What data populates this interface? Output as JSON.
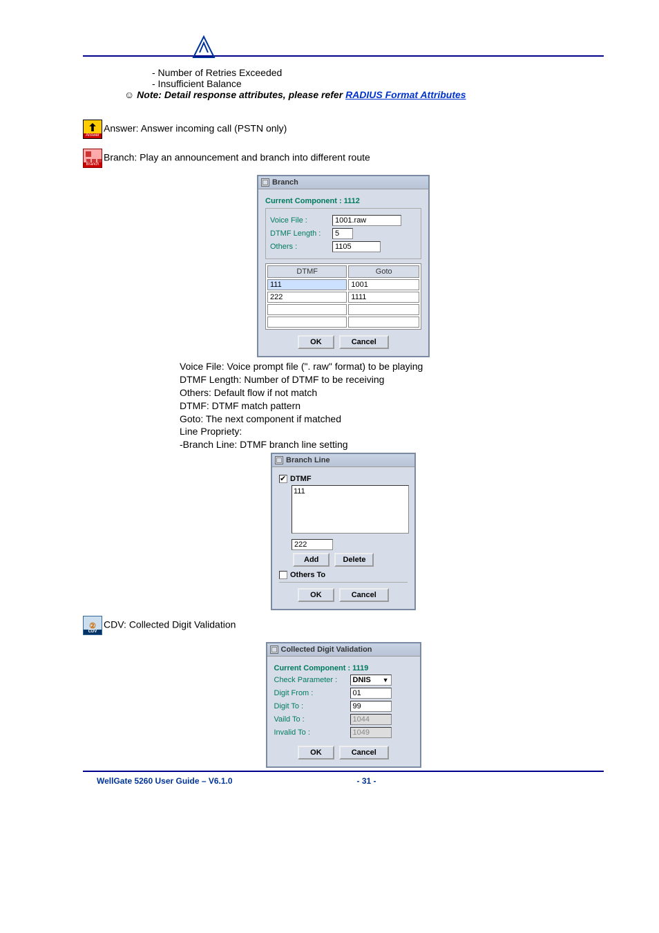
{
  "bullets": {
    "retries": "- Number of Retries Exceeded",
    "balance": "- Insufficient Balance"
  },
  "note": {
    "prefix": "☺ Note: Detail response attributes, please refer ",
    "link": "RADIUS Format Attributes"
  },
  "answer_line": "Answer: Answer incoming call (PSTN only)",
  "answer_icon_caption": "Answer",
  "branch_line": "Branch: Play an announcement and branch into different route",
  "branch_icon_caption": "Branch",
  "branch_dialog": {
    "title": "Branch",
    "current": "Current Component :  1112",
    "voice_label": "Voice File :",
    "voice_value": "1001.raw",
    "dtmf_len_label": "DTMF Length :",
    "dtmf_len_value": "5",
    "others_label": "Others :",
    "others_value": "1105",
    "col_dtmf": "DTMF",
    "col_goto": "Goto",
    "rows": [
      {
        "dtmf": "111",
        "goto": "1001"
      },
      {
        "dtmf": "222",
        "goto": "1111"
      }
    ],
    "ok": "OK",
    "cancel": "Cancel"
  },
  "desc": {
    "l1": "Voice File: Voice prompt file (\". raw\" format) to be playing",
    "l2": "DTMF Length: Number of DTMF to be receiving",
    "l3": "Others: Default flow if not match",
    "l4": "DTMF: DTMF match pattern",
    "l5": "Goto: The next component if matched",
    "l6": "Line Propriety:",
    "l7": "-Branch Line: DTMF branch line setting"
  },
  "branchline_dialog": {
    "title": "Branch Line",
    "dtmf_label": "DTMF",
    "dtmf_item": "111",
    "input_value": "222",
    "add": "Add",
    "delete": "Delete",
    "othersto_label": "Others To",
    "ok": "OK",
    "cancel": "Cancel"
  },
  "cdv_line": "CDV: Collected Digit Validation",
  "cdv_icon_caption": "CDV",
  "cdv_icon_glyph": "②",
  "cdv_dialog": {
    "title": "Collected Digit Validation",
    "current": "Current Component :  1119",
    "check_param_label": "Check Parameter :",
    "check_param_value": "DNIS",
    "digit_from_label": "Digit From :",
    "digit_from_value": "01",
    "digit_to_label": "Digit To :",
    "digit_to_value": "99",
    "vaild_to_label": "Vaild To :",
    "vaild_to_value": "1044",
    "invalid_to_label": "Invalid To :",
    "invalid_to_value": "1049",
    "ok": "OK",
    "cancel": "Cancel"
  },
  "footer": {
    "left": "WellGate 5260 User Guide – V6.1.0",
    "page": "- 31 -"
  }
}
